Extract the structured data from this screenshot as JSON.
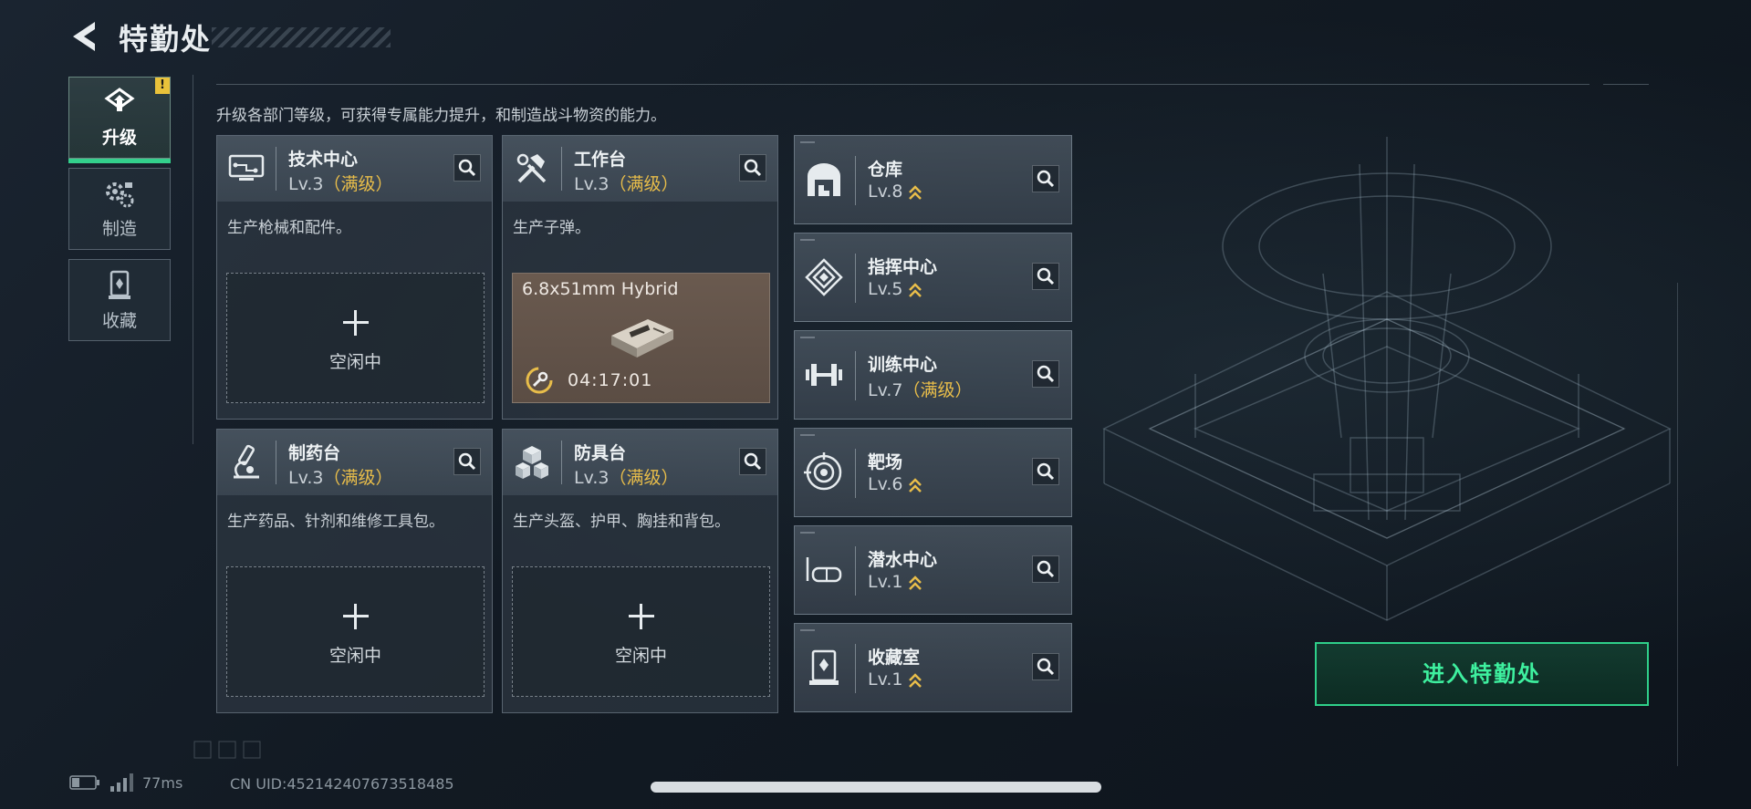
{
  "header": {
    "title": "特勤处",
    "intro": "升级各部门等级，可获得专属能力提升，和制造战斗物资的能力。"
  },
  "side_tabs": [
    {
      "label": "升级",
      "icon": "upgrade-icon",
      "active": true,
      "badge": "!"
    },
    {
      "label": "制造",
      "icon": "gears-icon",
      "active": false
    },
    {
      "label": "收藏",
      "icon": "collection-icon",
      "active": false
    }
  ],
  "facilities": [
    {
      "name": "技术中心",
      "level": "Lv.3",
      "max": "（满级）",
      "desc": "生产枪械和配件。",
      "slot": "空闲中",
      "icon": "tech-center-icon"
    },
    {
      "name": "工作台",
      "level": "Lv.3",
      "max": "（满级）",
      "desc": "生产子弹。",
      "icon": "workbench-icon",
      "crafting": {
        "item": "6.8x51mm Hybrid",
        "time": "04:17:01"
      }
    },
    {
      "name": "制药台",
      "level": "Lv.3",
      "max": "（满级）",
      "desc": "生产药品、针剂和维修工具包。",
      "slot": "空闲中",
      "icon": "pharmacy-icon"
    },
    {
      "name": "防具台",
      "level": "Lv.3",
      "max": "（满级）",
      "desc": "生产头盔、护甲、胸挂和背包。",
      "slot": "空闲中",
      "icon": "armor-bench-icon"
    }
  ],
  "rooms": [
    {
      "name": "仓库",
      "level": "Lv.8",
      "upgradable": true,
      "icon": "warehouse-icon"
    },
    {
      "name": "指挥中心",
      "level": "Lv.5",
      "upgradable": true,
      "icon": "command-center-icon"
    },
    {
      "name": "训练中心",
      "level": "Lv.7",
      "max": "（满级）",
      "upgradable": false,
      "icon": "dumbbell-icon"
    },
    {
      "name": "靶场",
      "level": "Lv.6",
      "upgradable": true,
      "icon": "target-icon"
    },
    {
      "name": "潜水中心",
      "level": "Lv.1",
      "upgradable": true,
      "icon": "diving-mask-icon"
    },
    {
      "name": "收藏室",
      "level": "Lv.1",
      "upgradable": true,
      "icon": "collection-room-icon"
    }
  ],
  "enter_button": "进入特勤处",
  "status": {
    "ping": "77ms",
    "uid": "CN UID:452142407673518485"
  },
  "colors": {
    "accent_green": "#2fd08a",
    "max_level_gold": "#e8bd4a",
    "alert_yellow": "#e9c23a"
  }
}
